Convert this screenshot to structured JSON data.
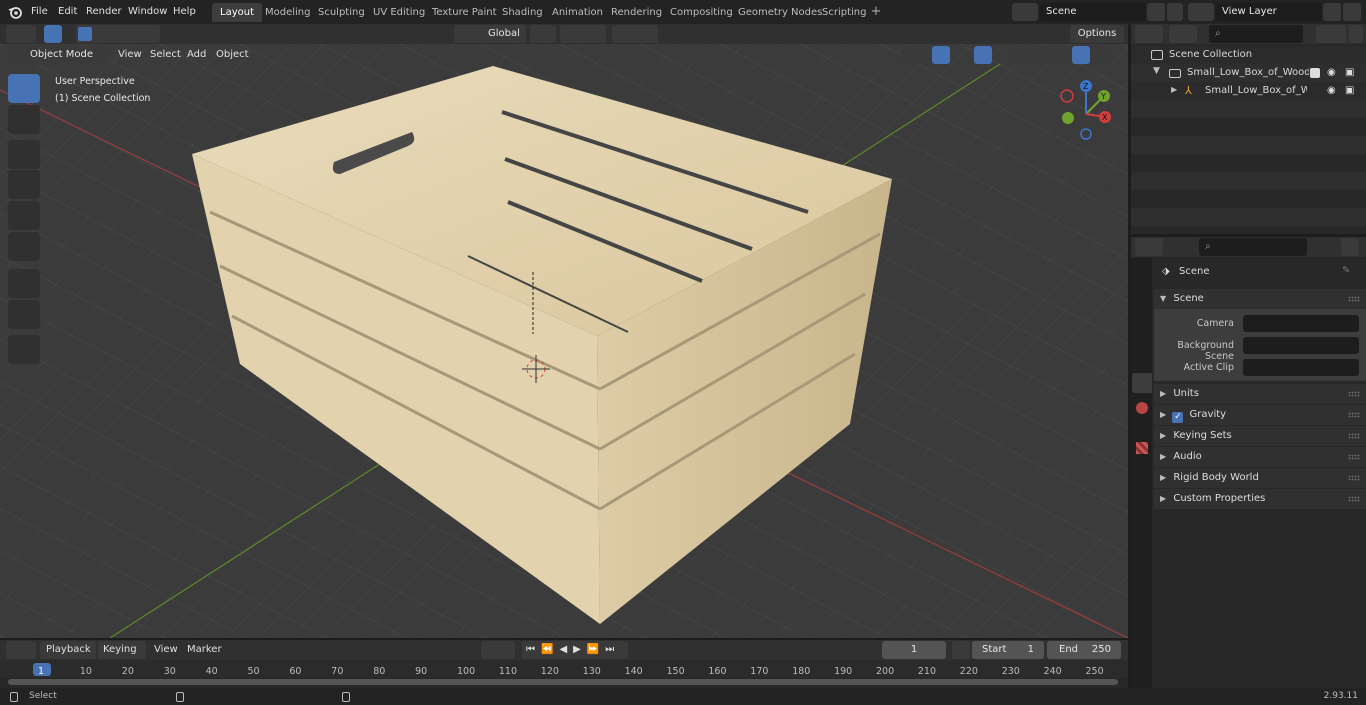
{
  "menus": [
    "File",
    "Edit",
    "Render",
    "Window",
    "Help"
  ],
  "workspaces": [
    "Layout",
    "Modeling",
    "Sculpting",
    "UV Editing",
    "Texture Paint",
    "Shading",
    "Animation",
    "Rendering",
    "Compositing",
    "Geometry Nodes",
    "Scripting"
  ],
  "active_workspace": "Layout",
  "scene_field": "Scene",
  "view_layer_field": "View Layer",
  "viewport": {
    "mode": "Object Mode",
    "menus": [
      "View",
      "Select",
      "Add",
      "Object"
    ],
    "transform_orientation": "Global",
    "options_label": "Options",
    "overlay_text_1": "User Perspective",
    "overlay_text_2": "(1) Scene Collection",
    "axes": {
      "x": "X",
      "y": "Y",
      "z": "Z"
    }
  },
  "outliner": {
    "rows": [
      "Scene Collection",
      "Small_Low_Box_of_Wooden_",
      "Small_Low_Box_of_Wooc"
    ]
  },
  "properties": {
    "header": "Scene",
    "section": "Scene",
    "fields": [
      "Camera",
      "Background Scene",
      "Active Clip"
    ],
    "panels": [
      "Units",
      "Gravity",
      "Keying Sets",
      "Audio",
      "Rigid Body World",
      "Custom Properties"
    ],
    "gravity_checked": true
  },
  "timeline": {
    "menus": [
      "Playback",
      "Keying",
      "View",
      "Marker"
    ],
    "current_frame": "1",
    "start_label": "Start",
    "start_value": "1",
    "end_label": "End",
    "end_value": "250",
    "ticks": [
      "1",
      "10",
      "20",
      "30",
      "40",
      "50",
      "60",
      "70",
      "80",
      "90",
      "100",
      "110",
      "120",
      "130",
      "140",
      "150",
      "160",
      "170",
      "180",
      "190",
      "200",
      "210",
      "220",
      "230",
      "240",
      "250"
    ]
  },
  "status": {
    "left": "Select",
    "version": "2.93.11"
  },
  "colors": {
    "accent": "#4772b3",
    "wood": "#e4d4af",
    "header": "#303030",
    "panel": "#282828"
  }
}
